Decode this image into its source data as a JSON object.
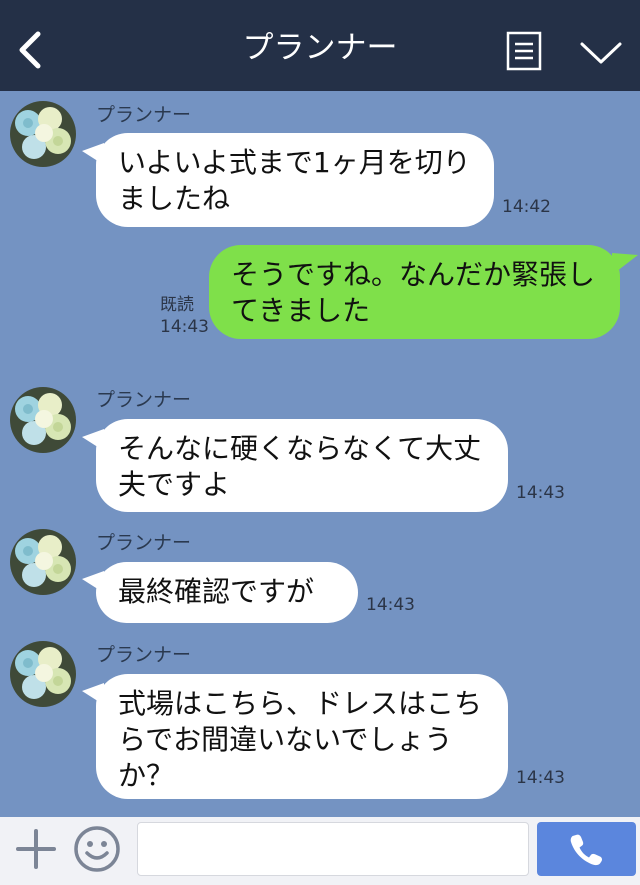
{
  "header": {
    "title": "プランナー",
    "back_icon": "chevron-left-icon",
    "menu_icon": "menu-list-icon",
    "collapse_icon": "chevron-down-icon",
    "background": "#243047"
  },
  "chat": {
    "background": "#7493c2",
    "messages": [
      {
        "direction": "incoming",
        "sender": "プランナー",
        "text": "いよいよ式まで1ヶ月を切りましたね",
        "time": "14:42"
      },
      {
        "direction": "outgoing",
        "text": "そうですね。なんだか緊張してきました",
        "read_label": "既読",
        "time": "14:43"
      },
      {
        "direction": "incoming",
        "sender": "プランナー",
        "text": "そんなに硬くならなくて大丈夫ですよ",
        "time": "14:43"
      },
      {
        "direction": "incoming",
        "sender": "プランナー",
        "text": "最終確認ですが",
        "time": "14:43"
      },
      {
        "direction": "incoming",
        "sender": "プランナー",
        "text": "式場はこちら、ドレスはこちらでお間違いないでしょうか？",
        "time": "14:43"
      }
    ]
  },
  "footer": {
    "plus_icon": "plus-icon",
    "sticker_icon": "smiley-icon",
    "message_input_value": "",
    "call_icon": "phone-icon",
    "call_button_color": "#5b86dd"
  },
  "colors": {
    "incoming_bubble": "#ffffff",
    "outgoing_bubble": "#7fe04a"
  }
}
